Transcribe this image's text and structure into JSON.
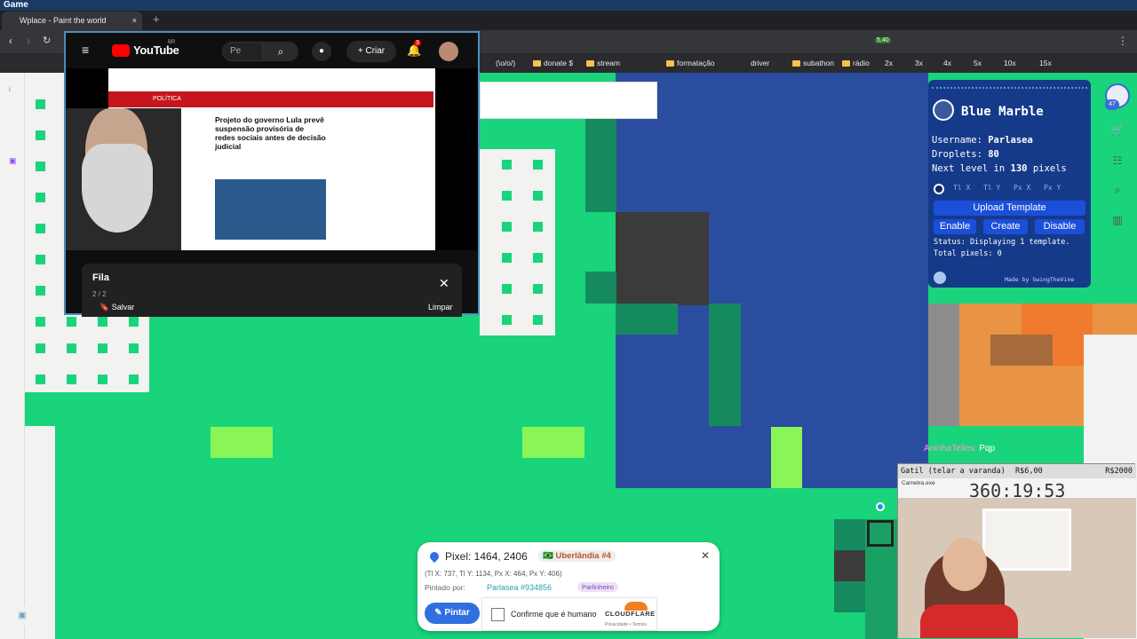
{
  "window": {
    "title": "Game"
  },
  "browser": {
    "tab_title": "Wplace - Paint the world",
    "tab_close": "×",
    "new_tab": "+",
    "bookmarks": [
      "(\\o/o/)",
      "donate $",
      "stream",
      "formatação",
      "driver",
      "subathon",
      "rádio",
      "2x",
      "3x",
      "4x",
      "5x",
      "10x",
      "15x"
    ],
    "ext_badge": "5,40"
  },
  "youtube": {
    "logo_text": "YouTube",
    "region": "BR",
    "search_text": "Pe",
    "create_label": "Criar",
    "notif_count": "3",
    "video": {
      "section": "POLÍTICA",
      "headline": "Projeto do governo Lula prevê suspensão provisória de redes sociais antes de decisão judicial"
    },
    "queue": {
      "title": "Fila",
      "count": "2 / 2",
      "save_label": "Salvar",
      "clear_label": "Limpar"
    }
  },
  "blue_marble": {
    "title": "Blue Marble",
    "username_label": "Username:",
    "username": "Parlasea",
    "droplets_label": "Droplets:",
    "droplets": "80",
    "next_level_label": "Next level in",
    "next_level_value": "130",
    "next_level_unit": "pixels",
    "coord_fields": [
      "Tl X",
      "Tl Y",
      "Px X",
      "Px Y"
    ],
    "upload_label": "Upload Template",
    "enable_label": "Enable",
    "create_label": "Create",
    "disable_label": "Disable",
    "status_text": "Status: Displaying 1 template. Total pixels: 0",
    "made_by": "Made by SwingTheVine"
  },
  "side_badge": "47",
  "chat": {
    "user": "AninhaTelles",
    "message": "Pqp"
  },
  "webcam": {
    "goal_text": "Gatil (telar a varanda)",
    "goal_current": "R$6,00",
    "goal_target": "R$2000",
    "window_label": "Carnetra.exe",
    "timer": "360:19:53"
  },
  "pixel_info": {
    "title": "Pixel: 1464, 2406",
    "location": "Uberlândia #4",
    "coords": "(Tl X: 737, Tl Y: 1134, Px X: 464, Px Y: 406)",
    "painted_by_label": "Pintado por:",
    "painter": "Parlasea #934856",
    "painter_badge": "Parlinheiro",
    "paint_button": "Pintar",
    "captcha_label": "Confirme que é humano",
    "captcha_brand": "CLOUDFLARE",
    "captcha_links": "Privacidade • Termos"
  },
  "colors": {
    "canvas_green": "#19d47a",
    "ocean_blue": "#2b4da0",
    "accent_blue": "#2f6fe0"
  }
}
